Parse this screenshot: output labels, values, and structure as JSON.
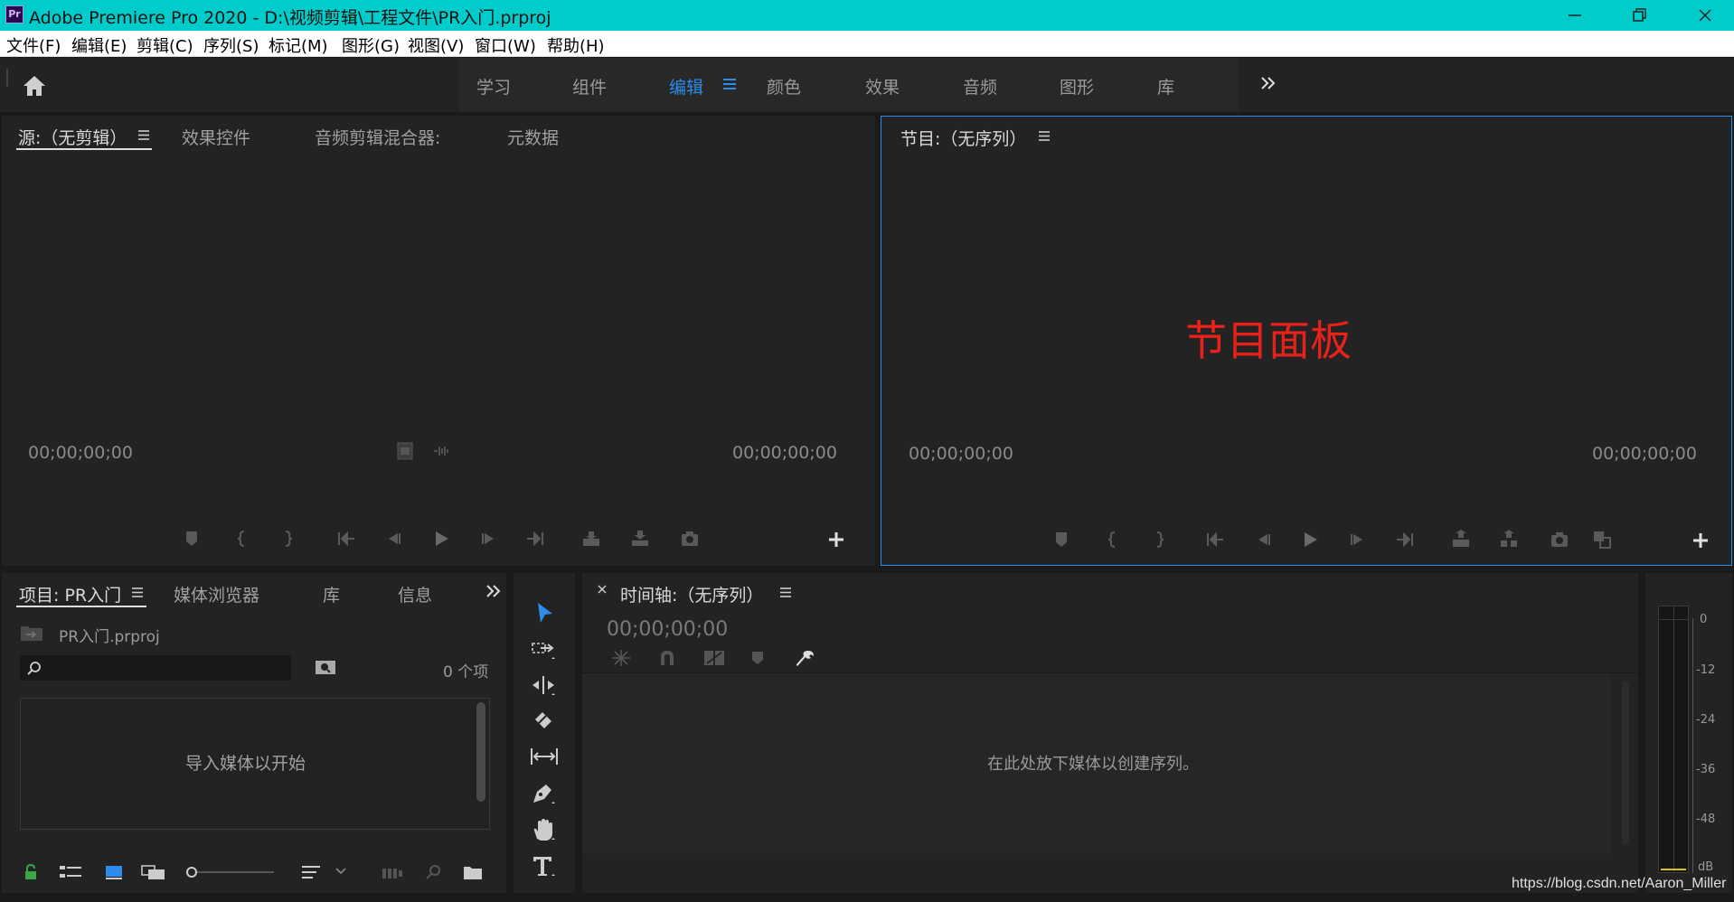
{
  "titlebar": {
    "logo": "Pr",
    "title": "Adobe Premiere Pro 2020 - D:\\视频剪辑\\工程文件\\PR入门.prproj"
  },
  "menu": [
    "文件(F)",
    "编辑(E)",
    "剪辑(C)",
    "序列(S)",
    "标记(M)",
    "图形(G)",
    "视图(V)",
    "窗口(W)",
    "帮助(H)"
  ],
  "workspaces": [
    "学习",
    "组件",
    "编辑",
    "颜色",
    "效果",
    "音频",
    "图形",
    "库"
  ],
  "active_workspace": "编辑",
  "source_panel": {
    "tabs": [
      "源:（无剪辑）",
      "效果控件",
      "音频剪辑混合器:",
      "元数据"
    ],
    "timecode_left": "00;00;00;00",
    "timecode_right": "00;00;00;00"
  },
  "program_panel": {
    "tab": "节目:（无序列）",
    "overlay_label": "节目面板",
    "overlay_color": "#e8221b",
    "timecode_left": "00;00;00;00",
    "timecode_right": "00;00;00;00"
  },
  "project_panel": {
    "tabs": [
      "项目: PR入门",
      "媒体浏览器",
      "库",
      "信息"
    ],
    "file_name": "PR入门.prproj",
    "item_count": "0 个项",
    "empty_message": "导入媒体以开始"
  },
  "timeline_panel": {
    "tab": "时间轴:（无序列）",
    "timecode": "00;00;00;00",
    "empty_message": "在此处放下媒体以创建序列。"
  },
  "audio_meter": {
    "labels": [
      "0",
      "-12",
      "-24",
      "-36",
      "-48",
      "dB"
    ]
  },
  "watermark": "https://blog.csdn.net/Aaron_Miller",
  "colors": {
    "titlebar": "#00cccc",
    "accent": "#2d8ceb",
    "panel": "#232323"
  }
}
